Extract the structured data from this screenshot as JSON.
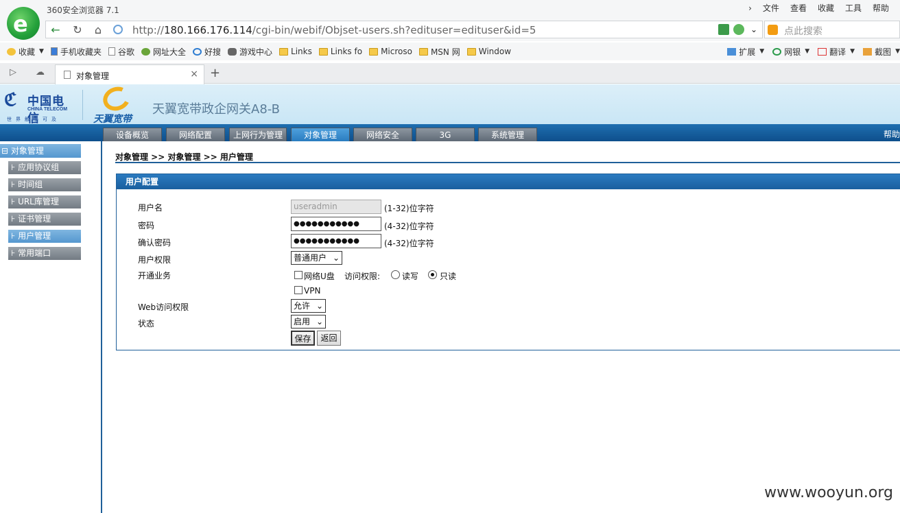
{
  "browser": {
    "title": "360安全浏览器 7.1",
    "menu": [
      "文件",
      "查看",
      "收藏",
      "工具",
      "帮助"
    ],
    "url_prefix": "http://",
    "url_host": "180.166.176.114",
    "url_path": "/cgi-bin/webif/Objset-users.sh?edituser=edituser&id=5",
    "search_placeholder": "点此搜索",
    "bookmarks": [
      "收藏",
      "手机收藏夹",
      "谷歌",
      "网址大全",
      "好搜",
      "游戏中心",
      "Links",
      "Links fo",
      "Microso",
      "MSN 网",
      "Window"
    ],
    "bookmarks_right": [
      "扩展",
      "网银",
      "翻译",
      "截图"
    ],
    "tab_title": "对象管理",
    "new_tab": "+",
    "tab_close": "×"
  },
  "header": {
    "brand_cn": "中国电信",
    "brand_en": "CHINA TELECOM",
    "slogan": "世界触手可及",
    "sub_brand": "天翼宽带",
    "product": "天翼宽带政企网关A8-B"
  },
  "nav": {
    "tabs": [
      "设备概览",
      "网络配置",
      "上网行为管理",
      "对象管理",
      "网络安全",
      "3G",
      "系统管理"
    ],
    "active": 3,
    "help": "帮助"
  },
  "sidebar": {
    "root": "对象管理",
    "items": [
      "应用协议组",
      "时间组",
      "URL库管理",
      "证书管理",
      "用户管理",
      "常用端口"
    ],
    "active": 4
  },
  "main": {
    "breadcrumb": "对象管理 >> 对象管理 >> 用户管理",
    "panel_title": "用户配置",
    "form": {
      "username_label": "用户名",
      "username_value": "useradmin",
      "username_hint": "(1-32)位字符",
      "password_label": "密码",
      "password_value": "●●●●●●●●●●●",
      "password_hint": "(4-32)位字符",
      "confirm_label": "确认密码",
      "confirm_value": "●●●●●●●●●●●",
      "confirm_hint": "(4-32)位字符",
      "role_label": "用户权限",
      "role_value": "普通用户",
      "service_label": "开通业务",
      "netdisk_label": "网络U盘",
      "access_label": "访问权限:",
      "rw_label": "读写",
      "ro_label": "只读",
      "vpn_label": "VPN",
      "web_label": "Web访问权限",
      "web_value": "允许",
      "status_label": "状态",
      "status_value": "启用",
      "save": "保存",
      "back": "返回"
    }
  },
  "watermark": "www.wooyun.org"
}
